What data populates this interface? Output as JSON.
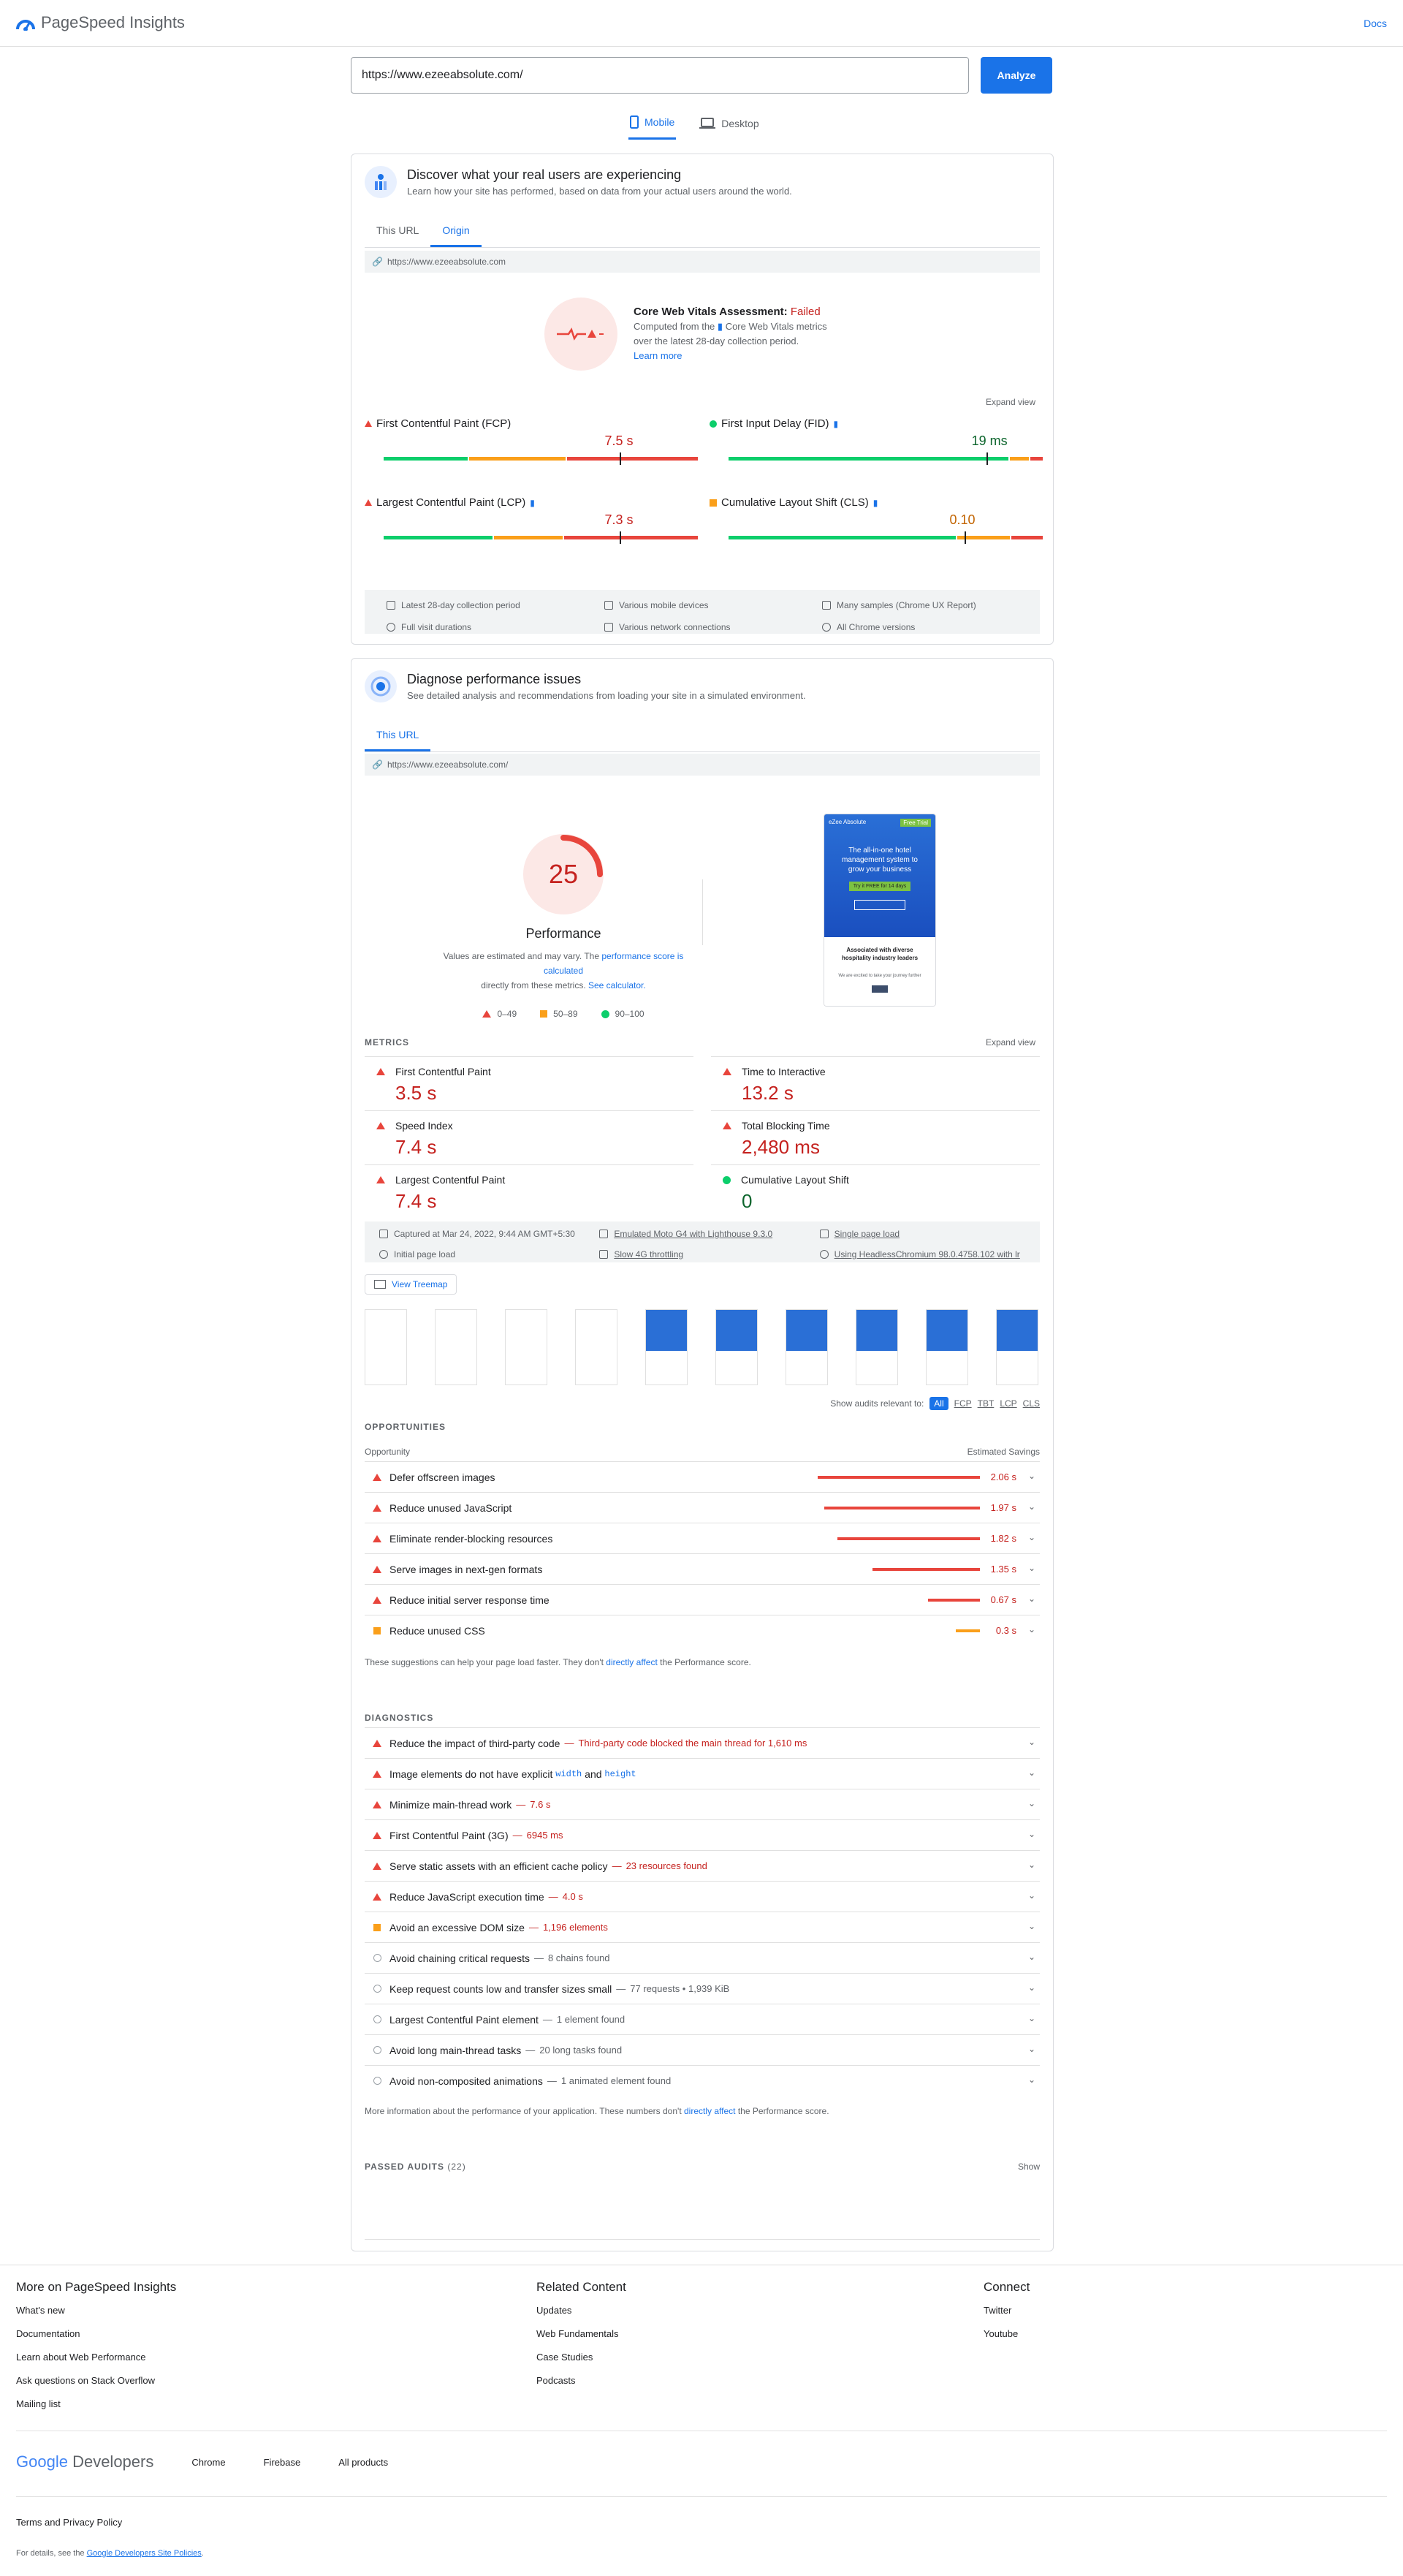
{
  "header": {
    "app_title": "PageSpeed Insights",
    "docs_label": "Docs"
  },
  "search": {
    "url_value": "https://www.ezeeabsolute.com/",
    "analyze_label": "Analyze"
  },
  "device_tabs": {
    "mobile": "Mobile",
    "desktop": "Desktop"
  },
  "field": {
    "title": "Discover what your real users are experiencing",
    "subtitle": "Learn how your site has performed, based on data from your actual users around the world.",
    "tabs": [
      "This URL",
      "Origin"
    ],
    "url": "https://www.ezeeabsolute.com",
    "assessment_title": "Core Web Vitals Assessment: ",
    "assessment_status": "Failed",
    "assessment_line1": "Computed from the",
    "assessment_line1b": "Core Web Vitals metrics",
    "assessment_line2": "over the latest 28-day collection period.",
    "learn_more": "Learn more",
    "expand": "Expand view",
    "metrics": [
      {
        "name": "First Contentful Paint (FCP)",
        "value": "7.5 s",
        "status": "poor",
        "dist": [
          0.27,
          0.31,
          0.42
        ],
        "marker": 0.75
      },
      {
        "name": "First Input Delay (FID)",
        "value": "19 ms",
        "status": "good",
        "dist": [
          0.9,
          0.06,
          0.04
        ],
        "marker": 0.82
      },
      {
        "name": "Largest Contentful Paint (LCP)",
        "value": "7.3 s",
        "status": "poor",
        "dist": [
          0.35,
          0.22,
          0.43
        ],
        "marker": 0.75
      },
      {
        "name": "Cumulative Layout Shift (CLS)",
        "value": "0.10",
        "status": "average",
        "dist": [
          0.73,
          0.17,
          0.1
        ],
        "marker": 0.75
      }
    ],
    "info": [
      "Latest 28-day collection period",
      "Various mobile devices",
      "Many samples (Chrome UX Report)",
      "Full visit durations",
      "Various network connections",
      "All Chrome versions"
    ]
  },
  "lab": {
    "title": "Diagnose performance issues",
    "subtitle": "See detailed analysis and recommendations from loading your site in a simulated environment.",
    "tab": "This URL",
    "url": "https://www.ezeeabsolute.com/",
    "score": "25",
    "score_value": 25,
    "score_label": "Performance",
    "note1": "Values are estimated and may vary. The",
    "note_link": "performance score is calculated",
    "note2": "directly from these metrics.",
    "note_link2": "See calculator.",
    "legend": [
      "0–49",
      "50–89",
      "90–100"
    ],
    "screenshot": {
      "brand": "eZee Absolute",
      "btn": "Free Trial",
      "headline": "The all-in-one hotel management system to grow your business",
      "cta": "Try it FREE for 14 days",
      "sub": "Associated with diverse hospitality industry leaders",
      "small": "We are excited to take your journey further"
    },
    "metrics_heading": "METRICS",
    "expand": "Expand view",
    "metrics": [
      {
        "name": "First Contentful Paint",
        "value": "3.5 s",
        "status": "poor"
      },
      {
        "name": "Time to Interactive",
        "value": "13.2 s",
        "status": "poor"
      },
      {
        "name": "Speed Index",
        "value": "7.4 s",
        "status": "poor"
      },
      {
        "name": "Total Blocking Time",
        "value": "2,480 ms",
        "status": "poor"
      },
      {
        "name": "Largest Contentful Paint",
        "value": "7.4 s",
        "status": "poor"
      },
      {
        "name": "Cumulative Layout Shift",
        "value": "0",
        "status": "good"
      }
    ],
    "info": [
      "Captured at Mar 24, 2022, 9:44 AM GMT+5:30",
      "Emulated Moto G4 with Lighthouse 9.3.0",
      "Single page load",
      "Initial page load",
      "Slow 4G throttling",
      "Using HeadlessChromium 98.0.4758.102 with lr"
    ],
    "treemap": "View Treemap",
    "filter_label": "Show audits relevant to:",
    "filters": [
      "All",
      "FCP",
      "TBT",
      "LCP",
      "CLS"
    ],
    "opportunities_heading": "OPPORTUNITIES",
    "opp_col1": "Opportunity",
    "opp_col2": "Estimated Savings",
    "opportunities": [
      {
        "name": "Defer offscreen images",
        "saving": "2.06 s",
        "status": "poor",
        "fraction": 1.0
      },
      {
        "name": "Reduce unused JavaScript",
        "saving": "1.97 s",
        "status": "poor",
        "fraction": 0.96
      },
      {
        "name": "Eliminate render-blocking resources",
        "saving": "1.82 s",
        "status": "poor",
        "fraction": 0.88
      },
      {
        "name": "Serve images in next-gen formats",
        "saving": "1.35 s",
        "status": "poor",
        "fraction": 0.66
      },
      {
        "name": "Reduce initial server response time",
        "saving": "0.67 s",
        "status": "poor",
        "fraction": 0.32
      },
      {
        "name": "Reduce unused CSS",
        "saving": "0.3 s",
        "status": "average",
        "fraction": 0.15
      }
    ],
    "opp_note1": "These suggestions can help your page load faster. They don't",
    "opp_note_link": "directly affect",
    "opp_note2": "the Performance score.",
    "diagnostics_heading": "DIAGNOSTICS",
    "diagnostics": [
      {
        "name": "Reduce the impact of third-party code",
        "detail": "Third-party code blocked the main thread for 1,610 ms",
        "status": "poor"
      },
      {
        "name": "Image elements do not have explicit",
        "code1": "width",
        "mid": "and",
        "code2": "height",
        "detail": "",
        "status": "poor"
      },
      {
        "name": "Minimize main-thread work",
        "detail": "7.6 s",
        "status": "poor"
      },
      {
        "name": "First Contentful Paint (3G)",
        "detail": "6945 ms",
        "status": "poor"
      },
      {
        "name": "Serve static assets with an efficient cache policy",
        "detail": "23 resources found",
        "status": "poor"
      },
      {
        "name": "Reduce JavaScript execution time",
        "detail": "4.0 s",
        "status": "poor"
      },
      {
        "name": "Avoid an excessive DOM size",
        "detail": "1,196 elements",
        "status": "average"
      },
      {
        "name": "Avoid chaining critical requests",
        "detail": "8 chains found",
        "status": "info"
      },
      {
        "name": "Keep request counts low and transfer sizes small",
        "detail": "77 requests • 1,939 KiB",
        "status": "info"
      },
      {
        "name": "Largest Contentful Paint element",
        "detail": "1 element found",
        "status": "info"
      },
      {
        "name": "Avoid long main-thread tasks",
        "detail": "20 long tasks found",
        "status": "info"
      },
      {
        "name": "Avoid non-composited animations",
        "detail": "1 animated element found",
        "status": "info"
      }
    ],
    "diag_note1": "More information about the performance of your application. These numbers don't",
    "diag_note_link": "directly affect",
    "diag_note2": "the Performance score.",
    "passed_label": "PASSED AUDITS",
    "passed_count": "(22)",
    "show": "Show"
  },
  "footer": {
    "col1_title": "More on PageSpeed Insights",
    "col1": [
      "What's new",
      "Documentation",
      "Learn about Web Performance",
      "Ask questions on Stack Overflow",
      "Mailing list"
    ],
    "col2_title": "Related Content",
    "col2": [
      "Updates",
      "Web Fundamentals",
      "Case Studies",
      "Podcasts"
    ],
    "col3_title": "Connect",
    "col3": [
      "Twitter",
      "Youtube"
    ],
    "brand_google": "Google",
    "brand_dev": "Developers",
    "products": [
      "Chrome",
      "Firebase",
      "All products"
    ],
    "terms": "Terms and Privacy Policy",
    "details1": "For details, see the",
    "details_link": "Google Developers Site Policies",
    "details2": "."
  },
  "colors": {
    "poor": "#e8453c",
    "average": "#fa9f1a",
    "good": "#0cce6b",
    "accent": "#1a73e8"
  }
}
